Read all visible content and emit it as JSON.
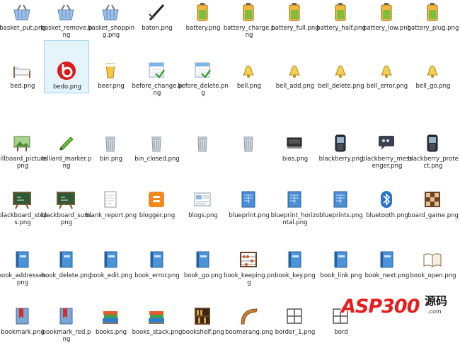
{
  "window": {
    "selected_file": "bedo.png"
  },
  "files": [
    {
      "name": "basket_put.png",
      "icon": "basket-icon"
    },
    {
      "name": "basket_remove.png",
      "icon": "basket-icon"
    },
    {
      "name": "basket_shopping.png",
      "icon": "basket-icon"
    },
    {
      "name": "baton.png",
      "icon": "baton-icon"
    },
    {
      "name": "battery.png",
      "icon": "battery-icon"
    },
    {
      "name": "battery_charge.png",
      "icon": "battery-icon"
    },
    {
      "name": "battery_full.png",
      "icon": "battery-icon"
    },
    {
      "name": "battery_half.png",
      "icon": "battery-icon"
    },
    {
      "name": "battery_low.png",
      "icon": "battery-icon"
    },
    {
      "name": "battery_plug.png",
      "icon": "battery-icon"
    },
    {
      "name": "bed.png",
      "icon": "bed-icon"
    },
    {
      "name": "bedo.png",
      "icon": "bedo-icon"
    },
    {
      "name": "beer.png",
      "icon": "beer-icon"
    },
    {
      "name": "before_change.png",
      "icon": "calendar-icon"
    },
    {
      "name": "before_delete.png",
      "icon": "calendar-icon"
    },
    {
      "name": "bell.png",
      "icon": "bell-icon"
    },
    {
      "name": "bell_add.png",
      "icon": "bell-icon"
    },
    {
      "name": "bell_delete.png",
      "icon": "bell-icon"
    },
    {
      "name": "bell_error.png",
      "icon": "bell-icon"
    },
    {
      "name": "bell_go.png",
      "icon": "bell-icon"
    },
    {
      "name": "billboard_picture.png",
      "icon": "billboard-icon"
    },
    {
      "name": "billiard_marker.png",
      "icon": "marker-icon"
    },
    {
      "name": "bin.png",
      "icon": "bin-icon"
    },
    {
      "name": "bin_closed.png",
      "icon": "bin-icon"
    },
    {
      "name": "",
      "icon": "bin-icon"
    },
    {
      "name": "",
      "icon": "bin-icon"
    },
    {
      "name": "bios.png",
      "icon": "bios-icon"
    },
    {
      "name": "blackberry.png",
      "icon": "phone-icon"
    },
    {
      "name": "blackberry_messenger.png",
      "icon": "messenger-icon"
    },
    {
      "name": "blackberry_protect.png",
      "icon": "phone-icon"
    },
    {
      "name": "blackboard_steps.png",
      "icon": "blackboard-icon"
    },
    {
      "name": "blackboard_sum.png",
      "icon": "blackboard-icon"
    },
    {
      "name": "blank_report.png",
      "icon": "notepad-icon"
    },
    {
      "name": "blogger.png",
      "icon": "blogger-icon"
    },
    {
      "name": "blogs.png",
      "icon": "blogs-icon"
    },
    {
      "name": "blueprint.png",
      "icon": "blueprint-icon"
    },
    {
      "name": "blueprint_horizontal.png",
      "icon": "blueprint-icon"
    },
    {
      "name": "blueprints.png",
      "icon": "blueprint-icon"
    },
    {
      "name": "bluetooth.png",
      "icon": "bluetooth-icon"
    },
    {
      "name": "board_game.png",
      "icon": "board-game-icon"
    },
    {
      "name": "book_addresses.png",
      "icon": "book-icon"
    },
    {
      "name": "book_delete.png",
      "icon": "book-icon"
    },
    {
      "name": "book_edit.png",
      "icon": "book-icon"
    },
    {
      "name": "book_error.png",
      "icon": "book-icon"
    },
    {
      "name": "book_go.png",
      "icon": "book-icon"
    },
    {
      "name": "book_keeping.png",
      "icon": "abacus-icon"
    },
    {
      "name": "book_key.png",
      "icon": "book-icon"
    },
    {
      "name": "book_link.png",
      "icon": "book-icon"
    },
    {
      "name": "book_next.png",
      "icon": "book-icon"
    },
    {
      "name": "book_open.png",
      "icon": "book-open-icon"
    },
    {
      "name": "bookmark.png",
      "icon": "bookmark-icon"
    },
    {
      "name": "bookmark_red.png",
      "icon": "bookmark-icon"
    },
    {
      "name": "books.png",
      "icon": "books-icon"
    },
    {
      "name": "books_stack.png",
      "icon": "books-icon"
    },
    {
      "name": "bookshelf.png",
      "icon": "bookshelf-icon"
    },
    {
      "name": "boomerang.png",
      "icon": "boomerang-icon"
    },
    {
      "name": "border_1.png",
      "icon": "border-icon"
    },
    {
      "name": "bord",
      "icon": "border-icon"
    },
    {
      "name": "",
      "icon": ""
    },
    {
      "name": "",
      "icon": ""
    }
  ],
  "watermark": {
    "brand": "ASP300",
    "cn": "源码",
    "domain": ".com"
  }
}
